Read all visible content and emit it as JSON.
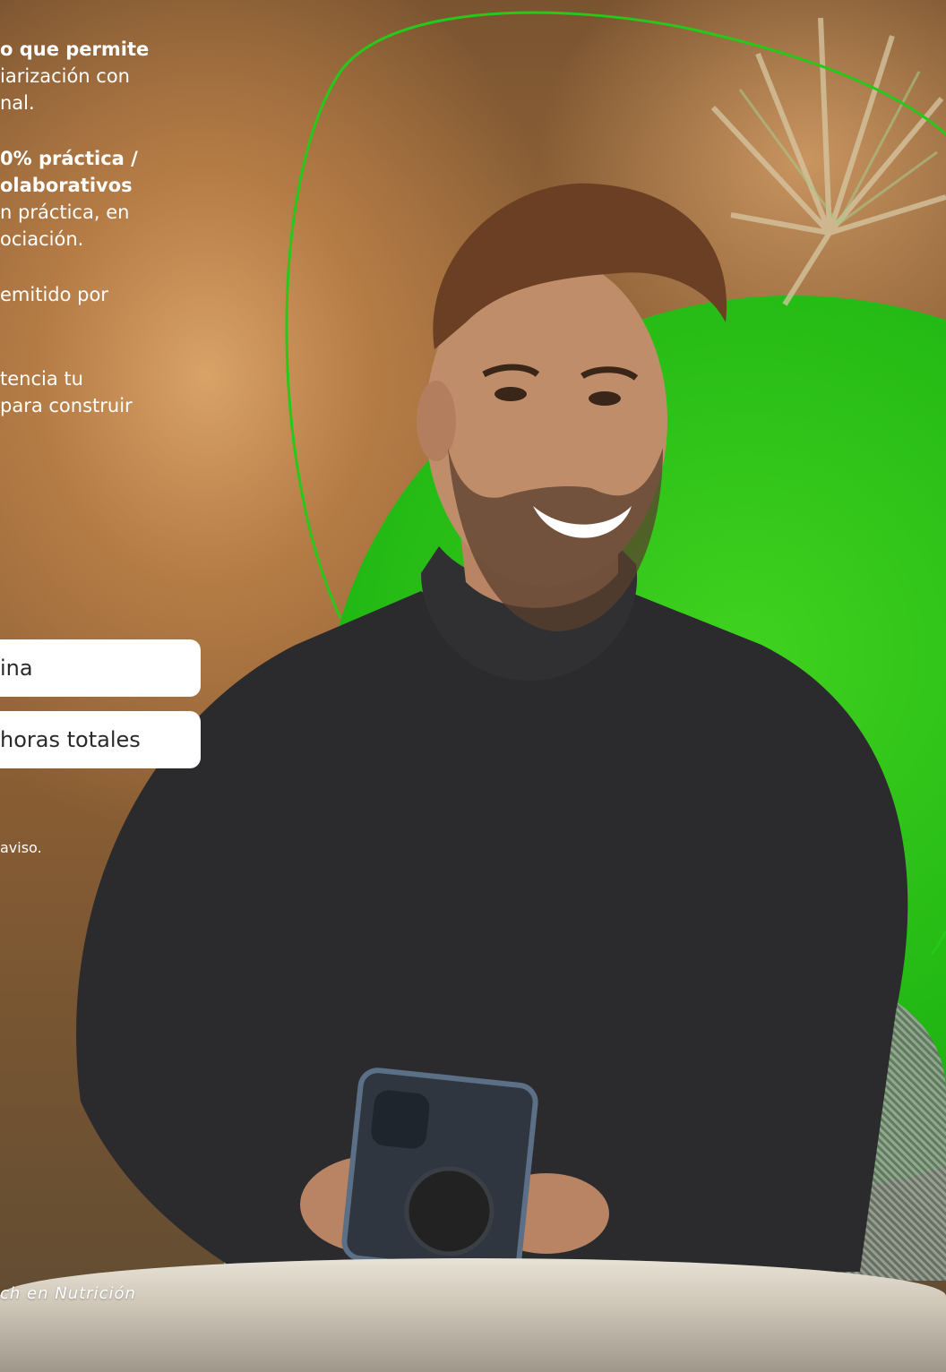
{
  "content": {
    "lines": [
      {
        "text": "o que permite",
        "bold": true
      },
      {
        "text": "iarización con",
        "bold": false
      },
      {
        "text": "nal.",
        "bold": false
      },
      {
        "text": "0% práctica /",
        "bold": true
      },
      {
        "text": "olaborativos",
        "bold": true
      },
      {
        "text": "n práctica, en",
        "bold": false
      },
      {
        "text": "ociación.",
        "bold": false
      },
      {
        "text": "emitido por",
        "bold": false
      },
      {
        "text": "tencia tu",
        "bold": false
      },
      {
        "text": "para construir",
        "bold": false
      }
    ],
    "pill_1": "ina",
    "pill_2": "horas totales",
    "note": "aviso.",
    "footer": "ch en Nutrición"
  },
  "colors": {
    "accent_green": "#22b814",
    "text": "#ffffff",
    "pill_bg": "#ffffff",
    "pill_text": "#2a2a2a"
  }
}
